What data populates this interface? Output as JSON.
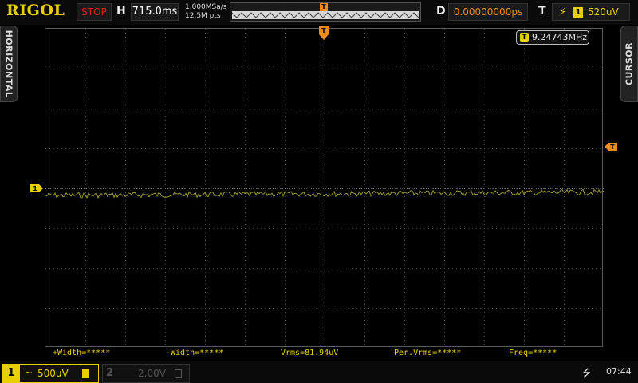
{
  "brand": {
    "logo": "RIGOL"
  },
  "topbar": {
    "run_status": "STOP",
    "horizontal_label": "H",
    "timebase": "715.0ms",
    "sample_rate": "1.000MSa/s",
    "memory_depth": "12.5M pts",
    "delay_label": "D",
    "delay_value": "0.00000000ps",
    "trigger_label": "T",
    "trigger_source": "1",
    "trigger_level": "520uV",
    "trigger_marker": "T"
  },
  "side_tabs": {
    "left": "HORIZONTAL",
    "right": "CURSOR"
  },
  "screen": {
    "frequency_badge": "T",
    "frequency": "9.24743MHz",
    "ch1_marker": "1",
    "trigger_level_marker": "T"
  },
  "measurements": [
    {
      "label": "+Width=*****"
    },
    {
      "label": "-Width=*****"
    },
    {
      "label": "Vrms=81.94uV"
    },
    {
      "label": "Per.Vrms=*****"
    },
    {
      "label": "Freq=*****"
    }
  ],
  "channels": {
    "ch1": {
      "number": "1",
      "coupling": "~",
      "scale": "500uV"
    },
    "ch2": {
      "number": "2",
      "scale": "2.00V"
    }
  },
  "status": {
    "usb_icon": "usb-icon",
    "time": "07:44"
  },
  "colors": {
    "ch1": "#e8d000",
    "trigger": "#f08c1c",
    "stop": "#e02020",
    "grid": "#5a5a5a"
  }
}
